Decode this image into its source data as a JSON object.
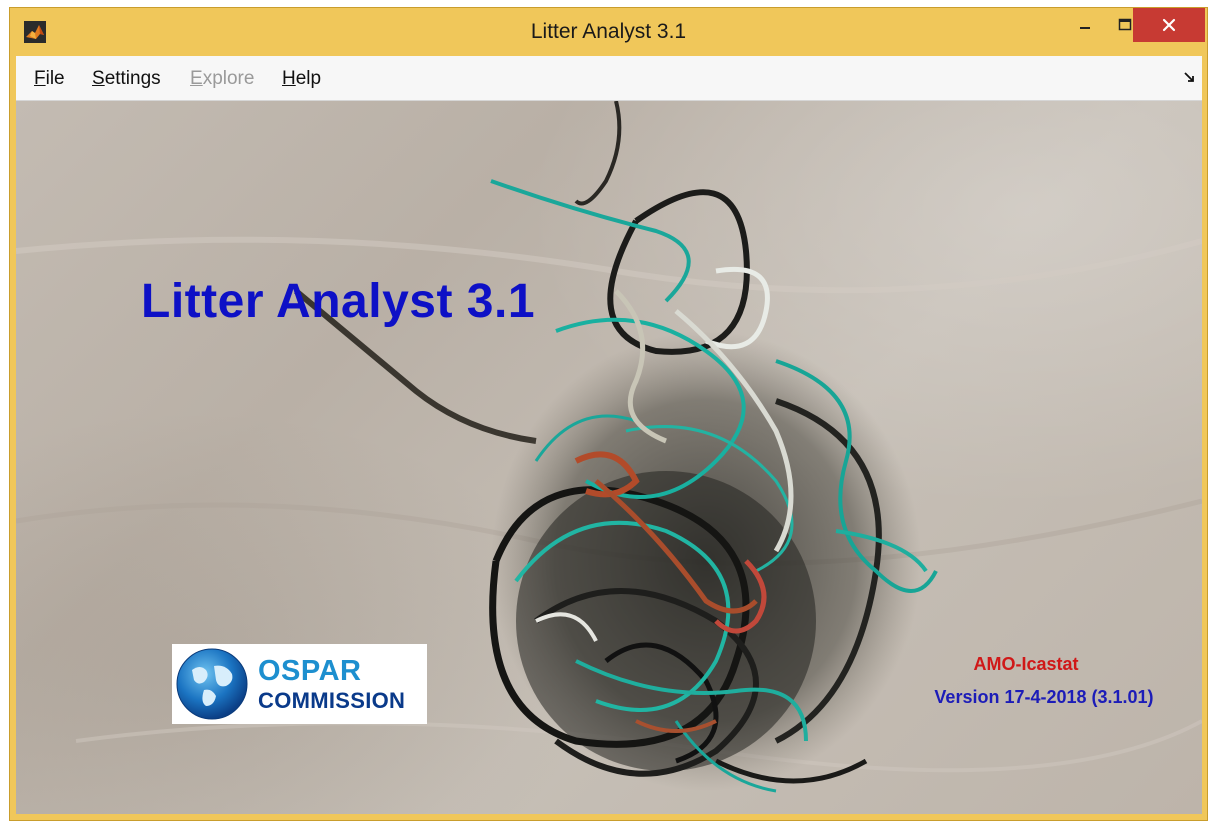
{
  "window": {
    "title": "Litter Analyst 3.1",
    "app_icon": "matlab-icon",
    "controls": {
      "minimize": "minimize-icon",
      "maximize": "maximize-icon",
      "close": "close-icon"
    }
  },
  "menu": {
    "items": [
      {
        "label": "File",
        "mnemonic": "F",
        "enabled": true
      },
      {
        "label": "Settings",
        "mnemonic": "S",
        "enabled": true
      },
      {
        "label": "Explore",
        "mnemonic": "E",
        "enabled": false
      },
      {
        "label": "Help",
        "mnemonic": "H",
        "enabled": true
      }
    ],
    "dock_icon": "undock-arrow-icon"
  },
  "splash": {
    "heading": "Litter Analyst 3.1",
    "logo": {
      "line1": "OSPAR",
      "line2": "COMMISSION"
    },
    "company": "AMO-Icastat",
    "version": "Version 17-4-2018 (3.1.01)"
  },
  "colors": {
    "titlebar": "#f0c75a",
    "close_button": "#c73a33",
    "heading": "#0d10c6",
    "company": "#d01818",
    "version": "#1c1cb8",
    "sand": "#c1b9b0"
  }
}
